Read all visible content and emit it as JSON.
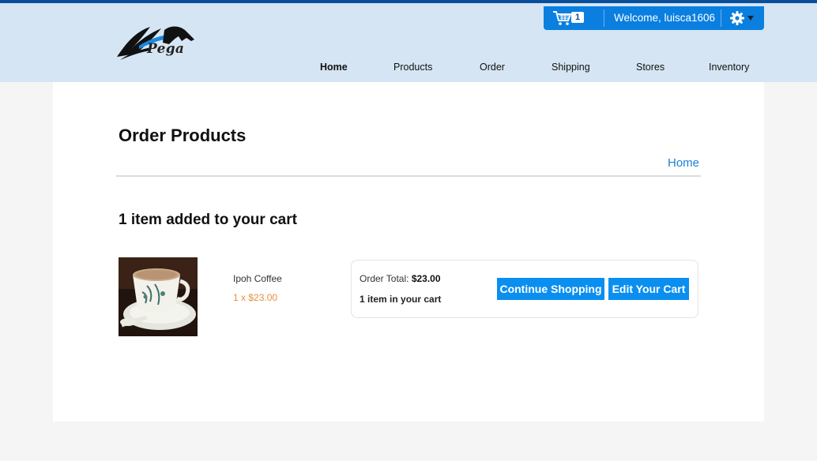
{
  "brand": {
    "logo_text": "Pega"
  },
  "userbar": {
    "cart_count": "1",
    "welcome": "Welcome, luisca1606",
    "cart_icon": "shopping-cart-icon",
    "settings_icon": "gear-icon"
  },
  "nav": {
    "items": [
      {
        "label": "Home",
        "active": true
      },
      {
        "label": "Products",
        "active": false
      },
      {
        "label": "Order",
        "active": false
      },
      {
        "label": "Shipping",
        "active": false
      },
      {
        "label": "Stores",
        "active": false
      },
      {
        "label": "Inventory",
        "active": false
      }
    ]
  },
  "page": {
    "title": "Order Products",
    "breadcrumb": "Home",
    "added_message": "1 item added to your cart"
  },
  "product": {
    "name": "Ipoh Coffee",
    "qty_price": "1 x $23.00"
  },
  "summary": {
    "total_label": "Order Total:",
    "total_value": "$23.00",
    "count_text": "1 item in your cart",
    "continue_label": "Continue Shopping",
    "edit_label": "Edit Your Cart"
  },
  "colors": {
    "accent": "#0a8ff0",
    "header_bg": "#d5e5f3",
    "link": "#1b7fd6",
    "price": "#e8903a"
  }
}
